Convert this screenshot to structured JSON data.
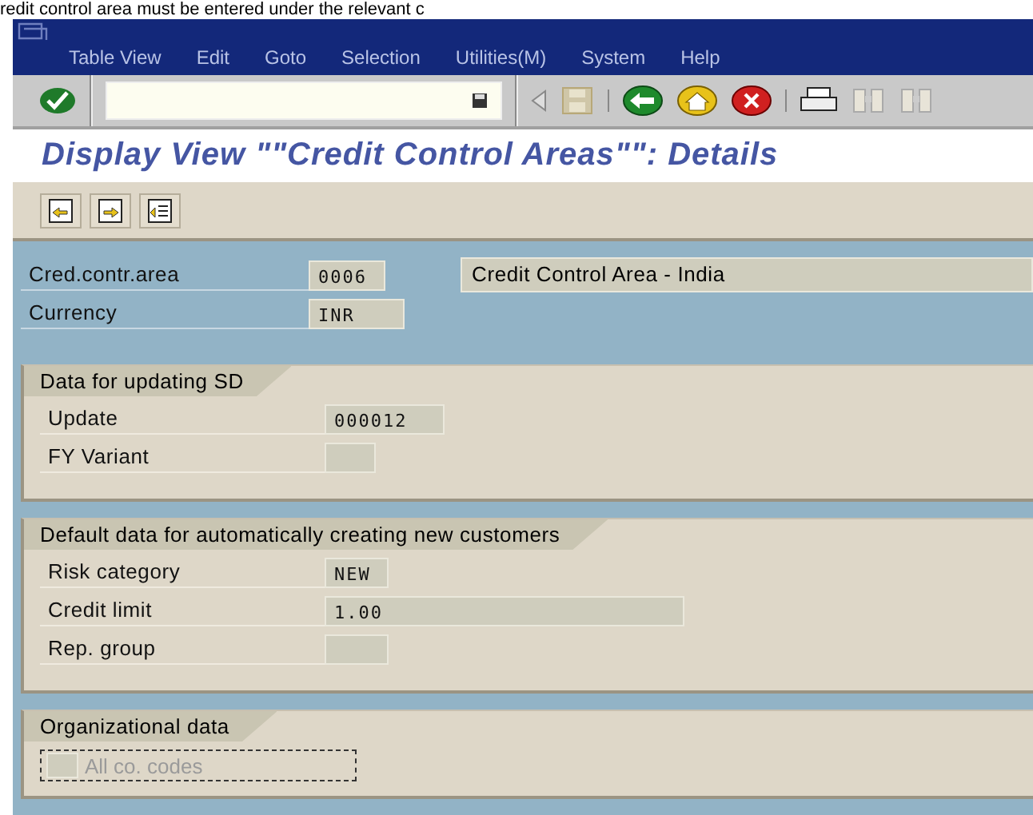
{
  "caption": "redit control area must be entered under the relevant c",
  "menu": [
    {
      "label": "Table View"
    },
    {
      "label": "Edit"
    },
    {
      "label": "Goto"
    },
    {
      "label": "Selection"
    },
    {
      "label": "Utilities(M)"
    },
    {
      "label": "System"
    },
    {
      "label": "Help"
    }
  ],
  "title": "Display View \"\"Credit Control Areas\"\": Details",
  "header_fields": [
    {
      "label": "Cred.contr.area",
      "value": "0006",
      "description": "Credit Control Area - India"
    },
    {
      "label": "Currency",
      "value": "INR"
    }
  ],
  "groups": [
    {
      "title": "Data for updating SD",
      "fields": [
        {
          "label": "Update",
          "value": "000012"
        },
        {
          "label": "FY Variant"
        }
      ]
    },
    {
      "title": "Default data for automatically creating new customers",
      "fields": [
        {
          "label": "Risk category",
          "value": "NEW"
        },
        {
          "label": "Credit limit",
          "value": "1.00"
        },
        {
          "label": "Rep. group"
        }
      ]
    },
    {
      "title": "Organizational data",
      "checkbox": {
        "label": "All co. codes",
        "checked": false,
        "disabled": true
      }
    }
  ]
}
